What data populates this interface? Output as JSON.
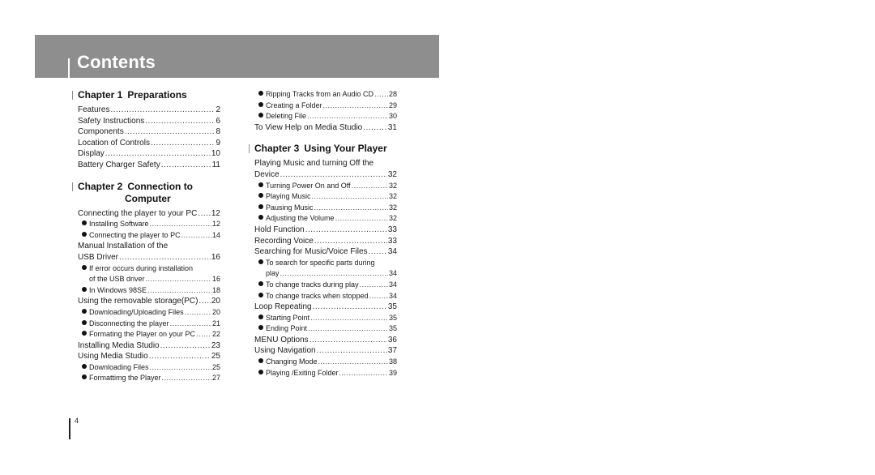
{
  "header": {
    "title": "Contents"
  },
  "chapters": [
    {
      "number": "Chapter 1",
      "title": "Preparations",
      "entries": [
        {
          "label": "Features",
          "page": "2",
          "level": 0
        },
        {
          "label": "Safety Instructions",
          "page": "6",
          "level": 0
        },
        {
          "label": "Components",
          "page": "8",
          "level": 0
        },
        {
          "label": "Location of Controls",
          "page": "9",
          "level": 0
        },
        {
          "label": "Display",
          "page": "10",
          "level": 0
        },
        {
          "label": "Battery Charger Safety",
          "page": "11",
          "level": 0
        }
      ]
    },
    {
      "number": "Chapter 2",
      "title": "Connection to",
      "title_line2": "Computer",
      "entries": [
        {
          "label": "Connecting the player to your PC",
          "page": "12",
          "level": 0
        },
        {
          "label": "Installing Software",
          "page": "12",
          "level": 1
        },
        {
          "label": "Connecting the player to PC",
          "page": "14",
          "level": 1
        },
        {
          "label": "Manual Installation of the",
          "label_cont": "USB Driver",
          "page": "16",
          "level": 0
        },
        {
          "label": "If error occurs during installation",
          "label_cont": "of the USB driver",
          "page": "16",
          "level": 1
        },
        {
          "label": "In Windows 98SE",
          "page": "18",
          "level": 1
        },
        {
          "label": "Using the removable storage(PC)",
          "page": "20",
          "level": 0
        },
        {
          "label": "Downloading/Uploading Files",
          "page": "20",
          "level": 1
        },
        {
          "label": "Disconnecting the player",
          "page": "21",
          "level": 1
        },
        {
          "label": "Formating the Player on your PC",
          "page": "22",
          "level": 1
        },
        {
          "label": "Installing Media Studio",
          "page": "23",
          "level": 0
        },
        {
          "label": "Using Media Studio",
          "page": "25",
          "level": 0
        },
        {
          "label": "Downloading Files",
          "page": "25",
          "level": 1
        },
        {
          "label": "Formattimg the Player",
          "page": "27",
          "level": 1
        },
        {
          "label": "Ripping Tracks from an Audio CD",
          "page": "28",
          "level": 1
        },
        {
          "label": "Creating a Folder",
          "page": "29",
          "level": 1
        },
        {
          "label": "Deleting File",
          "page": "30",
          "level": 1
        },
        {
          "label": "To View Help on Media Studio",
          "page": "31",
          "level": 0
        }
      ]
    },
    {
      "number": "Chapter 3",
      "title": "Using Your Player",
      "entries": [
        {
          "label": "Playing Music and turning Off the",
          "label_cont": "Device",
          "page": "32",
          "level": 0
        },
        {
          "label": "Turning Power On and Off",
          "page": "32",
          "level": 1
        },
        {
          "label": "Playing Music",
          "page": "32",
          "level": 1
        },
        {
          "label": "Pausing Music",
          "page": "32",
          "level": 1
        },
        {
          "label": "Adjusting the Volume",
          "page": "32",
          "level": 1
        },
        {
          "label": "Hold Function",
          "page": "33",
          "level": 0
        },
        {
          "label": "Recording Voice",
          "page": "33",
          "level": 0
        },
        {
          "label": "Searching for Music/Voice Files",
          "page": "34",
          "level": 0
        },
        {
          "label": "To search for specific parts during",
          "label_cont": "play",
          "page": "34",
          "level": 1
        },
        {
          "label": "To change tracks during play",
          "page": "34",
          "level": 1
        },
        {
          "label": "To change tracks when stopped",
          "page": "34",
          "level": 1
        },
        {
          "label": "Loop Repeating",
          "page": "35",
          "level": 0
        },
        {
          "label": "Starting Point",
          "page": "35",
          "level": 1
        },
        {
          "label": "Ending Point",
          "page": "35",
          "level": 1
        },
        {
          "label": "MENU Options",
          "page": "36",
          "level": 0
        },
        {
          "label": "Using Navigation",
          "page": "37",
          "level": 0
        },
        {
          "label": "Changing Mode",
          "page": "38",
          "level": 1
        },
        {
          "label": "Playing /Exiting Folder",
          "page": "39",
          "level": 1
        }
      ]
    }
  ],
  "footer": {
    "page_number": "4"
  }
}
